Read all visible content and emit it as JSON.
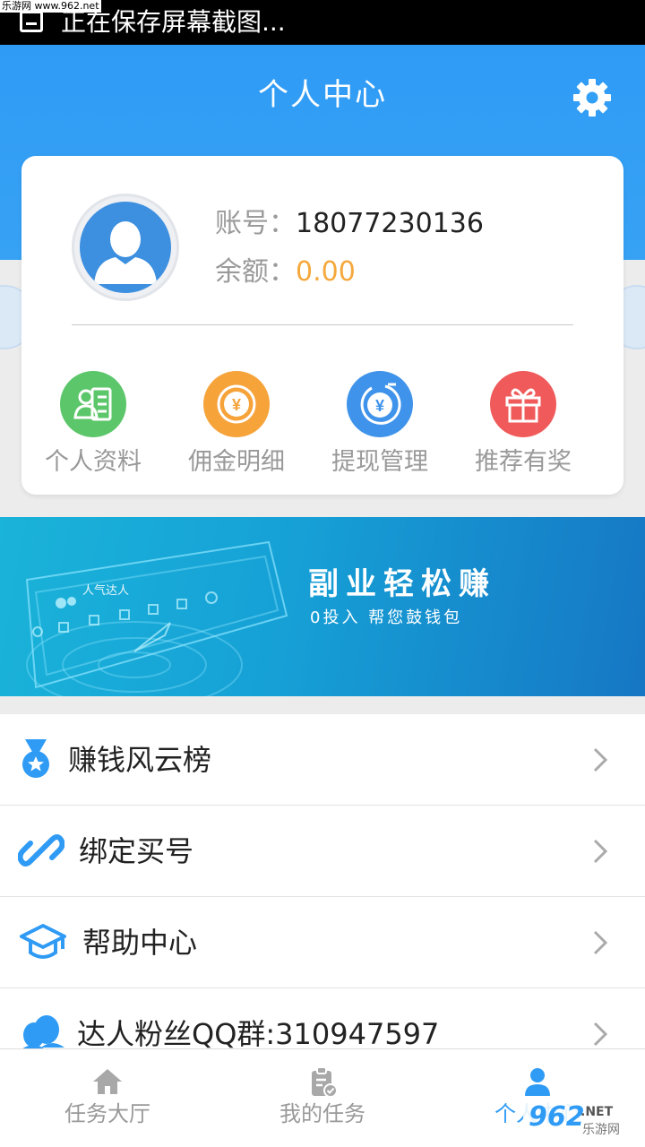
{
  "status_bar": {
    "text": "正在保存屏幕截图..."
  },
  "watermark": {
    "top_text": "乐游网 www.962.net",
    "bottom_brand": "962",
    "bottom_suffix": ".NET",
    "bottom_sub": "乐游网"
  },
  "header": {
    "title": "个人中心",
    "settings_icon": "gear-icon"
  },
  "account": {
    "account_label": "账号：",
    "account_value": "18077230136",
    "balance_label": "余额：",
    "balance_value": "0.00",
    "avatar_icon": "user-avatar-icon"
  },
  "quick_menu": [
    {
      "label": "个人资料",
      "icon": "contact-card-icon",
      "color": "#5cc66a"
    },
    {
      "label": "佣金明细",
      "icon": "coin-yuan-icon",
      "color": "#f6a33a"
    },
    {
      "label": "提现管理",
      "icon": "withdraw-yuan-icon",
      "color": "#3f93ea"
    },
    {
      "label": "推荐有奖",
      "icon": "gift-icon",
      "color": "#f05a5a"
    }
  ],
  "banner": {
    "title": "副业轻松赚",
    "subtitle": "0投入  帮您鼓钱包",
    "mock_app_name": "人气达人"
  },
  "list": [
    {
      "label": "赚钱风云榜",
      "icon": "medal-icon"
    },
    {
      "label": "绑定买号",
      "icon": "link-icon"
    },
    {
      "label": "帮助中心",
      "icon": "graduation-cap-icon"
    },
    {
      "label": "达人粉丝QQ群:310947597",
      "icon": "qq-group-icon"
    }
  ],
  "tabs": [
    {
      "label": "任务大厅",
      "icon": "home-icon",
      "active": false
    },
    {
      "label": "我的任务",
      "icon": "clipboard-check-icon",
      "active": false
    },
    {
      "label": "个人中心",
      "icon": "person-icon",
      "active": true
    }
  ],
  "colors": {
    "primary": "#2f9bf5",
    "balance": "#f5a83c",
    "label_gray": "#9a9a9a"
  }
}
